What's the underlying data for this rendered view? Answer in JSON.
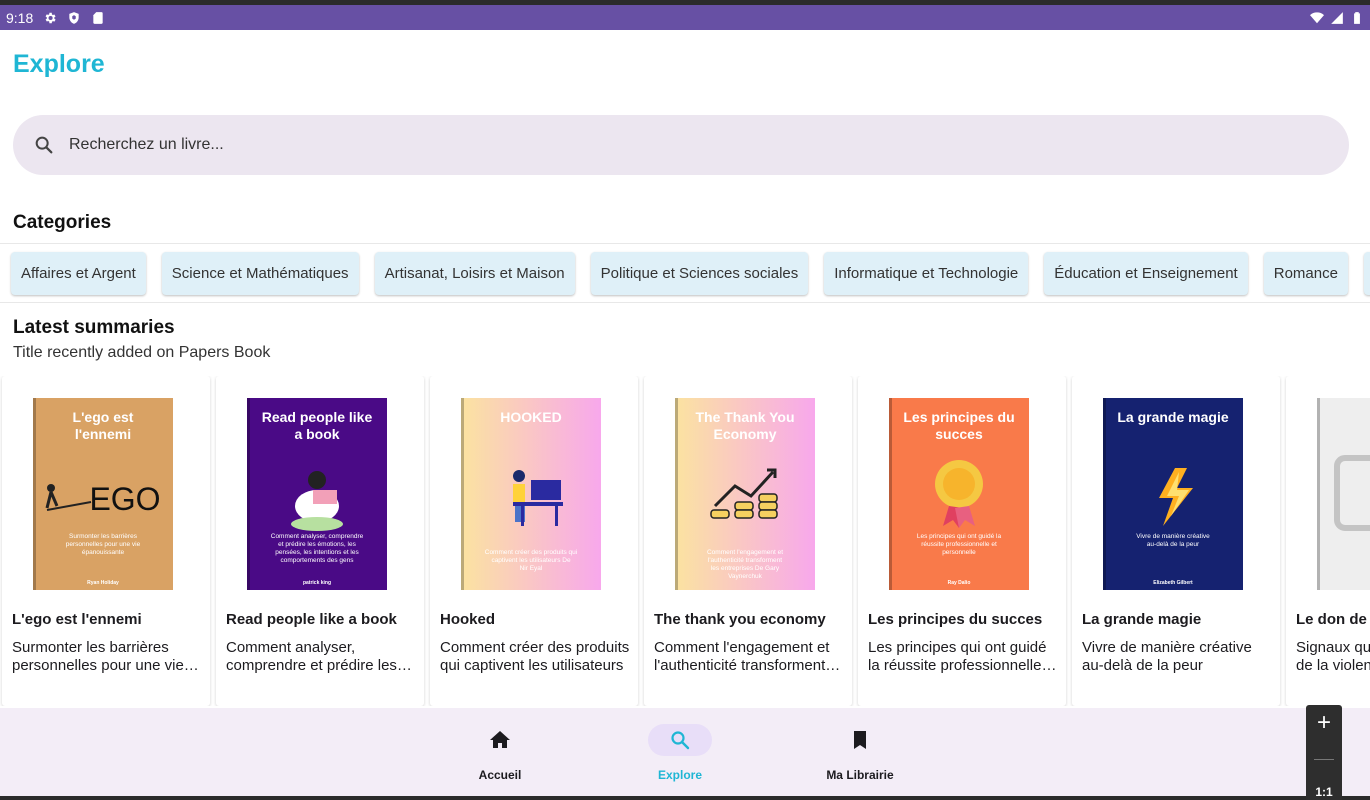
{
  "status_bar": {
    "time": "9:18"
  },
  "page_title": "Explore",
  "search": {
    "placeholder": "Recherchez un livre..."
  },
  "categories": {
    "title": "Categories",
    "items": [
      "Affaires et Argent",
      "Science et Mathématiques",
      "Artisanat, Loisirs et Maison",
      "Politique et Sciences sociales",
      "Informatique et Technologie",
      "Éducation et Enseignement",
      "Romance"
    ]
  },
  "latest": {
    "title": "Latest summaries",
    "subtitle": "Title recently added on Papers Book",
    "books": [
      {
        "title": "L'ego est l'ennemi",
        "description": "Surmonter les barrières personnelles pour une vie épanouissante",
        "cover": {
          "heading": "L'ego est l'ennemi",
          "art": "EGO",
          "tagline": "Surmonter les barrières personnelles pour une vie épanouissante",
          "author": "Ryan Holiday",
          "bg": "#d9a264",
          "text_color": "#ffffff"
        }
      },
      {
        "title": "Read people like a book",
        "description": "Comment analyser, comprendre et prédire les émotions, les pensées, les intentions et les comportements des gens",
        "cover": {
          "heading": "Read people like a book",
          "tagline": "Comment analyser, comprendre et prédire les émotions, les pensées, les intentions et les comportements des gens",
          "author": "patrick king",
          "bg": "#4a0a86",
          "text_color": "#ffffff"
        }
      },
      {
        "title": "Hooked",
        "description": "Comment créer des produits qui captivent les utilisateurs",
        "cover": {
          "heading": "HOOKED",
          "tagline": "Comment créer des produits qui captivent les utilisateurs De Nir Eyal",
          "bg": "#fbe3a0",
          "bg2": "#f8a8ec",
          "text_color": "#ffffff"
        }
      },
      {
        "title": "The thank you economy",
        "description": "Comment l'engagement et l'authenticité transforment les entreprises",
        "cover": {
          "heading": "The Thank You Economy",
          "tagline": "Comment l'engagement et l'authenticité transforment les entreprises De Gary Vaynerchuk",
          "bg": "#fbe3a0",
          "bg2": "#f8a8ec",
          "text_color": "#ffffff"
        }
      },
      {
        "title": "Les principes du succes",
        "description": "Les principes qui ont guidé la réussite professionnelle et personnelle",
        "cover": {
          "heading": "Les principes du succes",
          "tagline": "Les principes qui ont guidé la réussite professionnelle et personnelle",
          "author": "Ray Dalio",
          "bg": "#f97a4a",
          "text_color": "#ffffff"
        }
      },
      {
        "title": "La grande magie",
        "description": "Vivre de manière créative au-delà de la peur",
        "cover": {
          "heading": "La grande magie",
          "tagline": "Vivre de manière créative au-delà de la peur",
          "author": "Elizabeth Gilbert",
          "bg": "#152270",
          "text_color": "#ffffff"
        }
      },
      {
        "title": "Le don de la peur",
        "description": "Signaux qui nous protègent de la violence",
        "cover": {
          "bg": "#eeeeee"
        }
      }
    ]
  },
  "bottom_nav": {
    "items": [
      {
        "label": "Accueil",
        "icon": "home-icon",
        "active": false
      },
      {
        "label": "Explore",
        "icon": "search-icon",
        "active": true
      },
      {
        "label": "Ma Librairie",
        "icon": "bookmark-icon",
        "active": false
      }
    ]
  },
  "zoom_controls": {
    "plus": "+",
    "ratio": "1:1"
  },
  "colors": {
    "accent": "#1fb6d4",
    "status_bar": "#6750a4",
    "search_bg": "#ece6f0",
    "chip_bg": "#dff0f8",
    "nav_bg": "#f3edf7",
    "nav_pill": "#e8def8"
  }
}
